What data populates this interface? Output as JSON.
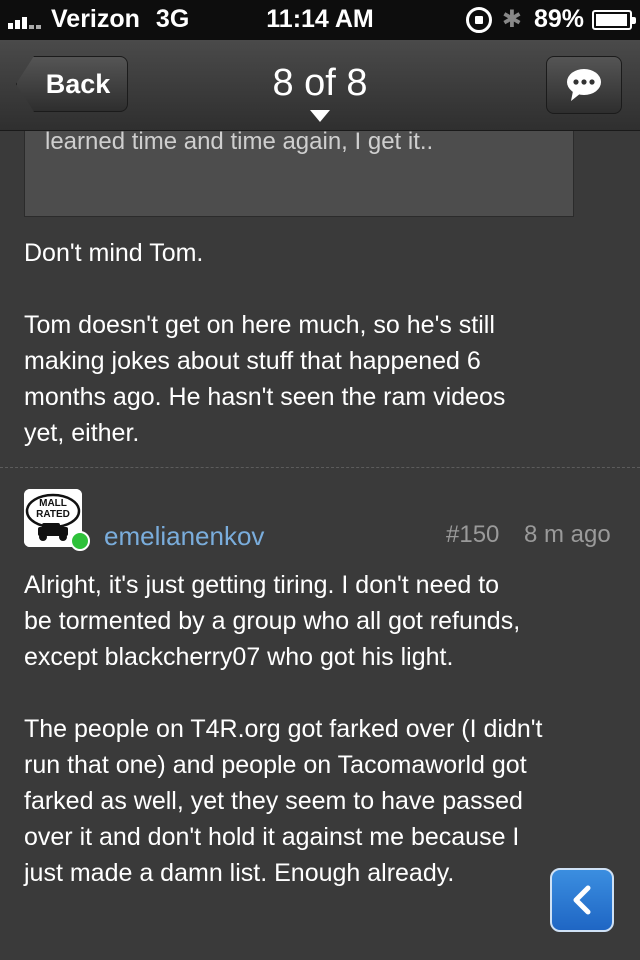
{
  "status_bar": {
    "carrier": "Verizon",
    "network": "3G",
    "time": "11:14 AM",
    "battery": "89%",
    "icons": [
      "signal-icon",
      "rotation-lock-icon",
      "bluetooth-icon",
      "battery-icon"
    ]
  },
  "nav": {
    "back_label": "Back",
    "title": "8 of 8",
    "chat_icon": "chat-bubble-icon"
  },
  "quote": {
    "text": "learned time and time again, I get it.."
  },
  "post1": {
    "lines": [
      "Don't mind Tom.",
      "",
      "Tom doesn't get on here much, so he's still",
      "making jokes about stuff that happened 6",
      "months ago. He hasn't seen the ram videos",
      "yet, either."
    ]
  },
  "post2": {
    "avatar_text_1": "MALL",
    "avatar_text_2": "RATED",
    "username": "emelianenkov",
    "post_number": "#150",
    "time_ago": "8 m ago",
    "lines": [
      "Alright, it's just getting tiring. I don't need to",
      "be tormented by a group who all got refunds,",
      "except blackcherry07 who got his light.",
      "",
      "The people on T4R.org got farked over (I didn't",
      "run that one) and people on Tacomaworld got",
      "farked as well, yet they seem to have passed",
      "over it and don't hold it against me because I",
      "just made a damn list. Enough already."
    ]
  },
  "colors": {
    "background": "#3a3a3a",
    "username": "#7aaddc",
    "online": "#2ec13a",
    "accent_button": "#2a78d6"
  }
}
